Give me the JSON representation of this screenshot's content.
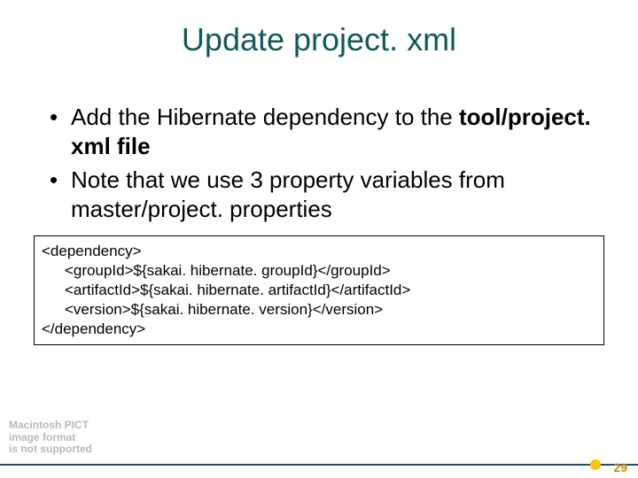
{
  "title": "Update project. xml",
  "bullets": [
    {
      "pre": "Add the Hibernate dependency to the ",
      "bold": "tool/project. xml file",
      "post": ""
    },
    {
      "pre": "Note that we use 3 property variables from master/project. properties",
      "bold": "",
      "post": ""
    }
  ],
  "code": {
    "open": "<dependency>",
    "lines": [
      "<groupId>${sakai. hibernate. groupId}</groupId>",
      "<artifactId>${sakai. hibernate. artifactId}</artifactId>",
      "<version>${sakai. hibernate. version}</version>"
    ],
    "close": "</dependency>"
  },
  "placeholder": {
    "l1": "Macintosh PICT",
    "l2": "image format",
    "l3": "is not supported"
  },
  "page_number": "29"
}
